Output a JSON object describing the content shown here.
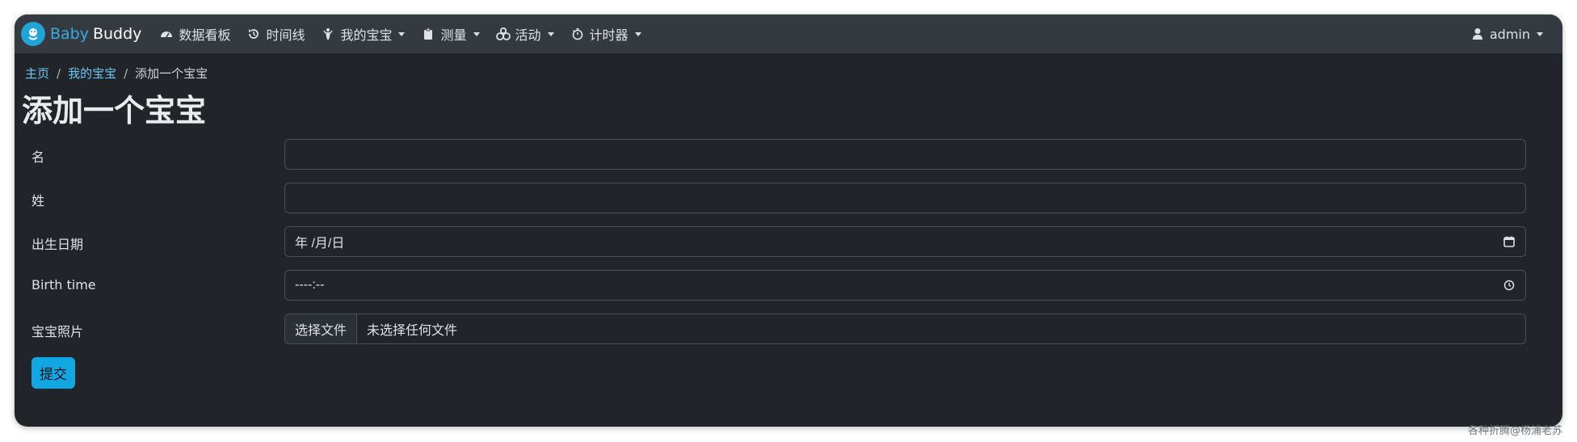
{
  "nav": {
    "brand_baby": "Baby",
    "brand_buddy": "Buddy",
    "items": [
      {
        "label": "数据看板",
        "icon": "dashboard-icon",
        "dropdown": false
      },
      {
        "label": "时间线",
        "icon": "history-icon",
        "dropdown": false
      },
      {
        "label": "我的宝宝",
        "icon": "baby-icon",
        "dropdown": true
      },
      {
        "label": "测量",
        "icon": "clipboard-icon",
        "dropdown": true
      },
      {
        "label": "活动",
        "icon": "activities-icon",
        "dropdown": true
      },
      {
        "label": "计时器",
        "icon": "stopwatch-icon",
        "dropdown": true
      }
    ],
    "user": "admin"
  },
  "breadcrumb": {
    "home": "主页",
    "children": "我的宝宝",
    "current": "添加一个宝宝"
  },
  "page_title": "添加一个宝宝",
  "form": {
    "first_name": {
      "label": "名",
      "value": ""
    },
    "last_name": {
      "label": "姓",
      "value": ""
    },
    "birth_date": {
      "label": "出生日期",
      "value": "年 /月/日"
    },
    "birth_time": {
      "label": "Birth time",
      "value": "----:--"
    },
    "photo": {
      "label": "宝宝照片",
      "button": "选择文件",
      "status": "未选择任何文件"
    },
    "submit": "提交"
  },
  "watermark": "各种折腾@杨浦老苏",
  "colors": {
    "background": "#212529",
    "navbar": "#343a40",
    "accent": "#11a7e2",
    "link": "#6ec6f5"
  }
}
